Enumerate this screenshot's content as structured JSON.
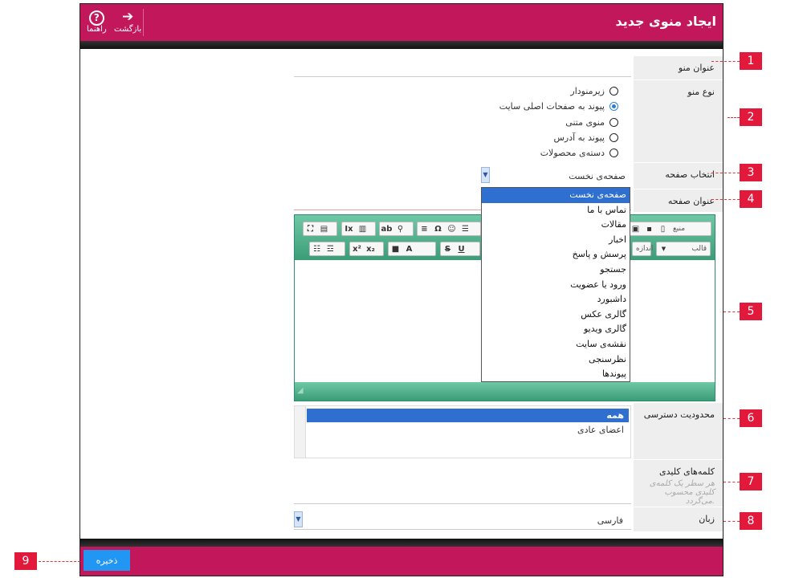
{
  "header": {
    "title": "ایجاد منوی جدید",
    "back_label": "بازگشت",
    "help_label": "راهنما"
  },
  "form": {
    "menu_title_label": "عنوان منو",
    "menu_type_label": "نوع منو",
    "menu_types": [
      {
        "label": "زیرمنودار",
        "selected": false
      },
      {
        "label": "پیوند به صفحات اصلی سایت",
        "selected": true
      },
      {
        "label": "منوی متنی",
        "selected": false
      },
      {
        "label": "پیوند به آدرس",
        "selected": false
      },
      {
        "label": "دسته‌ی محصولات",
        "selected": false
      }
    ],
    "page_select_label": "انتخاب صفحه",
    "page_select_value": "صفحه‌ی نخست",
    "page_title_label": "عنوان صفحه",
    "page_options": [
      "صفحه‌ی نخست",
      "تماس با ما",
      "مقالات",
      "اخبار",
      "پرسش و پاسخ",
      "جستجو",
      "ورود یا عضویت",
      "داشبورد",
      "گالری عکس",
      "گالری ویدیو",
      "نقشه‌ی سایت",
      "نظرسنجی",
      "پیوندها"
    ],
    "access_label": "محدودیت دسترسی",
    "access_options": [
      {
        "label": "همه",
        "selected": true
      },
      {
        "label": "اعضای عادی",
        "selected": false
      }
    ],
    "keywords_label": "کلمه‌های کلیدی",
    "keywords_hint": "هر سطر یک کلمه‌ی کلیدی محسوب می‌گردد.",
    "language_label": "زبان",
    "language_value": "فارسی"
  },
  "editor": {
    "source_label": "منبع",
    "format_label": "قالب",
    "size_label": "اندازه"
  },
  "footer": {
    "save_label": "ذخیره"
  },
  "callouts": [
    "1",
    "2",
    "3",
    "4",
    "5",
    "6",
    "7",
    "8",
    "9"
  ],
  "colors": {
    "brand": "#c2185b",
    "editor_toolbar": "#3b9c78",
    "selection": "#2f6fd0",
    "callout": "#e3193b"
  }
}
